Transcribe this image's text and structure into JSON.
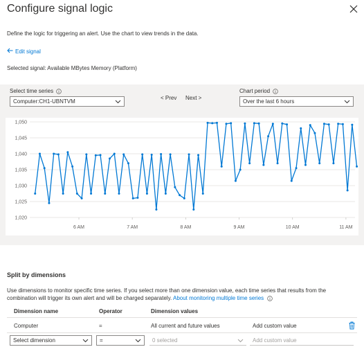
{
  "header": {
    "title": "Configure signal logic",
    "description": "Define the logic for triggering an alert. Use the chart to view trends in the data.",
    "edit_signal": "Edit signal",
    "selected_signal": "Selected signal: Available MBytes Memory (Platform)"
  },
  "controls": {
    "time_series_label": "Select time series",
    "time_series_value": "Computer:CH1-UBNTVM",
    "prev": "< Prev",
    "next": "Next >",
    "period_label": "Chart period",
    "period_value": "Over the last 6 hours"
  },
  "chart_data": {
    "type": "line",
    "y_ticks": [
      "1,050",
      "1,045",
      "1,040",
      "1,035",
      "1,030",
      "1,025",
      "1,020"
    ],
    "ylim": [
      1020,
      1050
    ],
    "x_ticks": [
      {
        "label": "6 AM",
        "t": 6.0
      },
      {
        "label": "7 AM",
        "t": 7.0
      },
      {
        "label": "8 AM",
        "t": 8.0
      },
      {
        "label": "9 AM",
        "t": 9.0
      },
      {
        "label": "10 AM",
        "t": 10.0
      },
      {
        "label": "11 AM",
        "t": 11.0
      }
    ],
    "xlim": [
      5.08,
      11.17
    ],
    "series": [
      {
        "color": "#0078d4",
        "x_start": 5.18,
        "x_step": 0.0873,
        "values": [
          1027.5,
          1040,
          1035.5,
          1024.5,
          1040,
          1039.8,
          1027.5,
          1040.5,
          1036,
          1027.5,
          1026,
          1039.8,
          1027.5,
          1039.5,
          1039.6,
          1027.5,
          1038.5,
          1040,
          1027.5,
          1039.8,
          1037,
          1026,
          1026.2,
          1039.8,
          1027.5,
          1039.7,
          1022.5,
          1039.9,
          1027.5,
          1039.8,
          1029.5,
          1027,
          1026,
          1039.8,
          1022.5,
          1039.6,
          1027.5,
          1049.7,
          1049.6,
          1049.7,
          1036,
          1049.4,
          1049.6,
          1031.5,
          1035,
          1049.5,
          1037,
          1049.6,
          1049.5,
          1036.5,
          1045.5,
          1049.4,
          1037,
          1049.5,
          1049.2,
          1031.5,
          1035.5,
          1048,
          1036.5,
          1049,
          1046.5,
          1037,
          1049.4,
          1049.2,
          1037,
          1049.4,
          1049.3,
          1028.5,
          1049.1,
          1036
        ]
      }
    ]
  },
  "split": {
    "title": "Split by dimensions",
    "description": "Use dimensions to monitor specific time series. If you select more than one dimension value, each time series that results from the combination will trigger its own alert and will be charged separately.",
    "link": "About monitoring multiple time series",
    "columns": [
      "Dimension name",
      "Operator",
      "Dimension values"
    ],
    "row": {
      "name": "Computer",
      "operator": "=",
      "values": "All current and future values",
      "custom": "Add custom value"
    },
    "new_row": {
      "name_placeholder": "Select dimension",
      "operator": "=",
      "values_placeholder": "0 selected",
      "custom_placeholder": "Add custom value"
    }
  }
}
